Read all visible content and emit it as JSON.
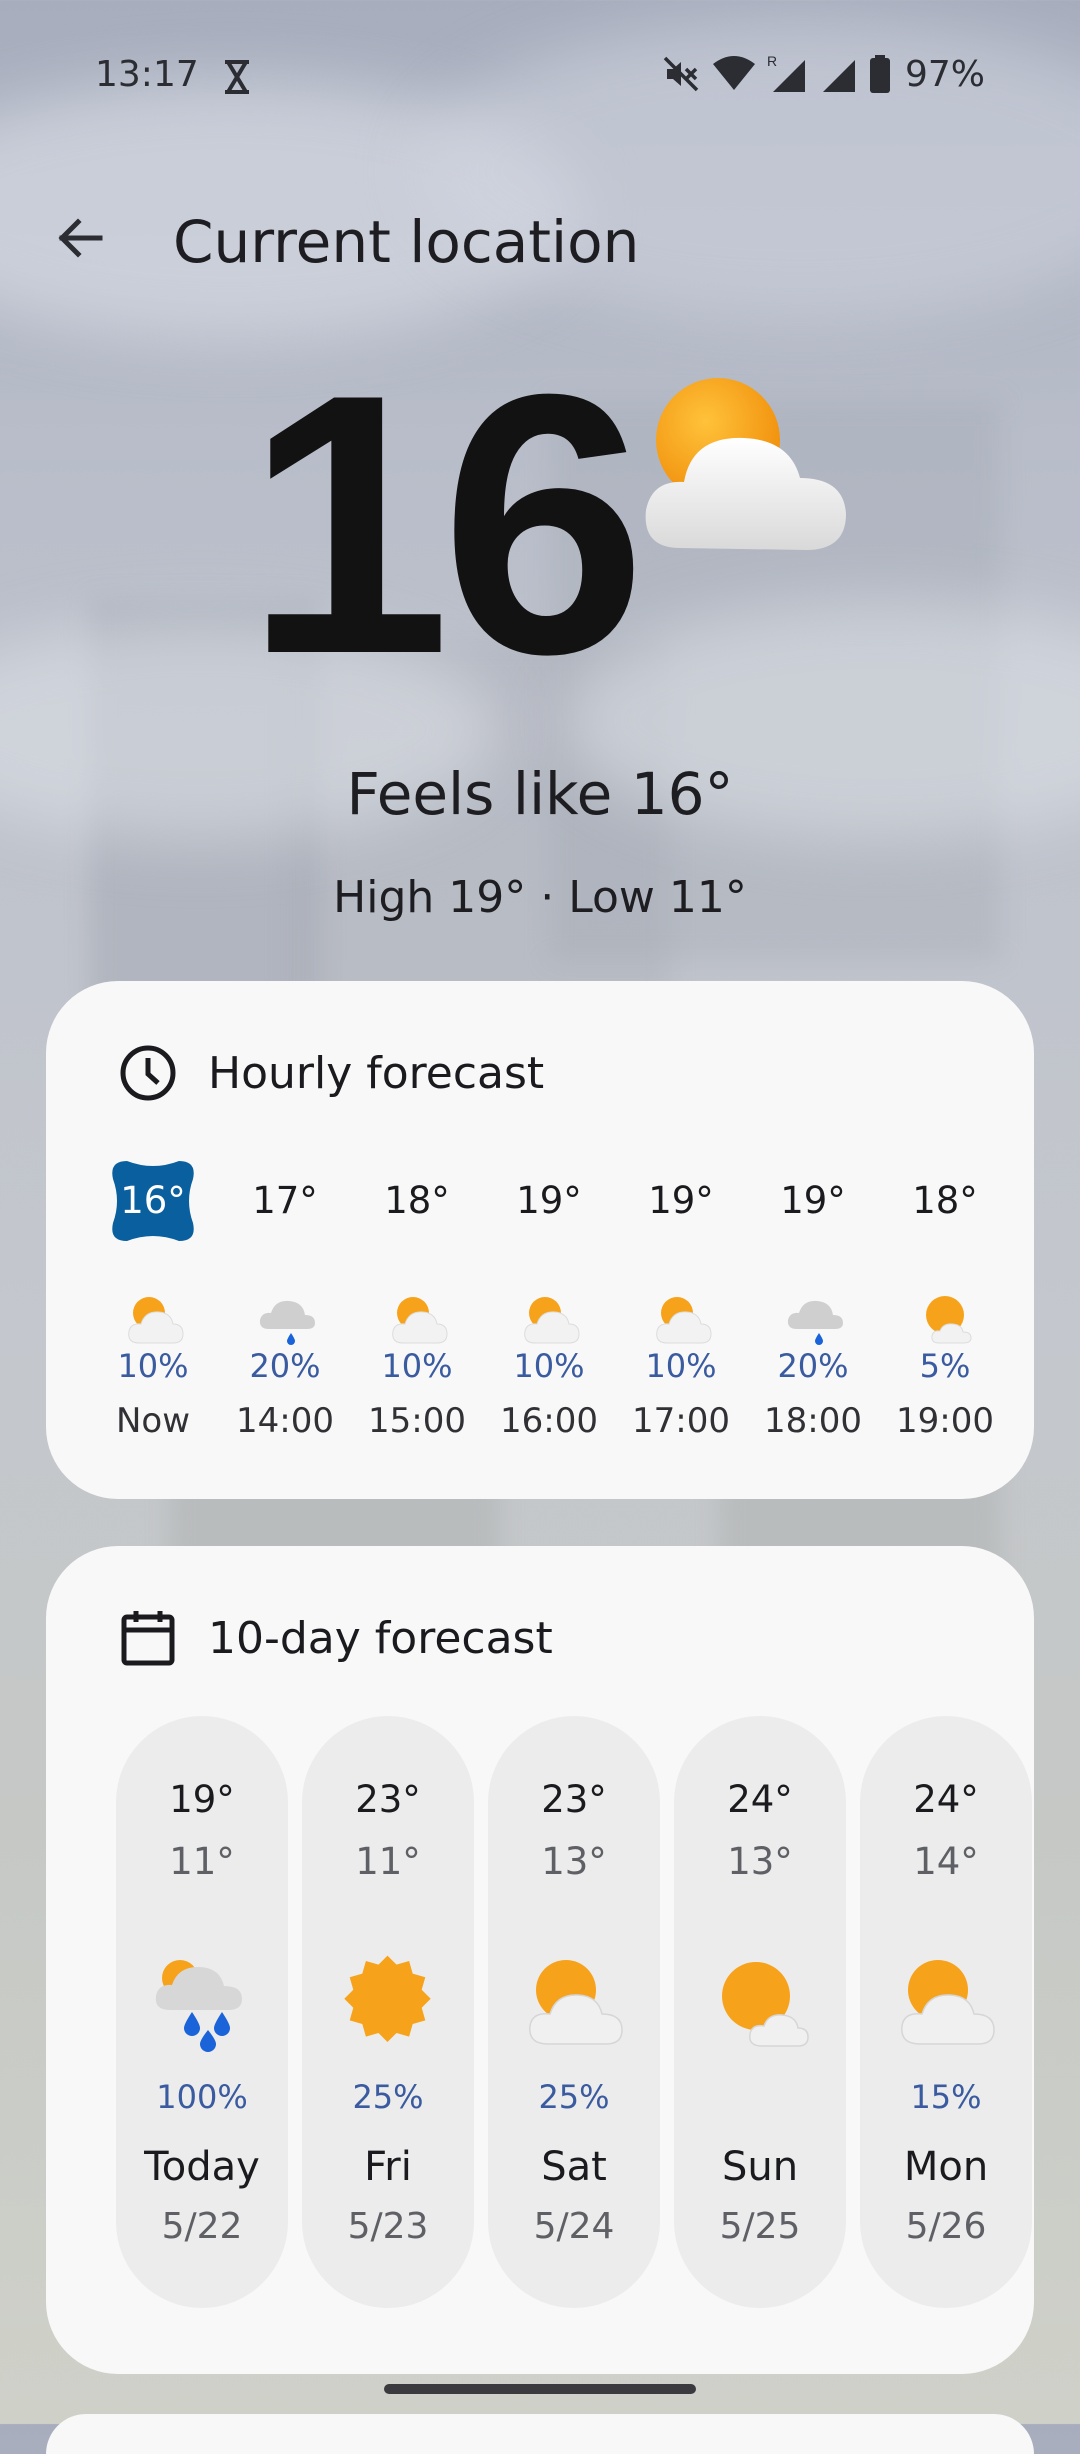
{
  "status_bar": {
    "time": "13:17",
    "battery": "97%",
    "icons": [
      "hourglass-icon",
      "mute-icon",
      "wifi-icon",
      "signal-roaming-icon",
      "signal-icon",
      "battery-icon"
    ]
  },
  "header": {
    "back_icon": "arrow-left-icon",
    "title": "Current location"
  },
  "current": {
    "temperature": "16",
    "condition_icon": "partly-cloudy-icon",
    "feels_like": "Feels like 16°",
    "high_low": "High 19° · Low 11°"
  },
  "hourly": {
    "title": "Hourly forecast",
    "icon": "clock-icon",
    "items": [
      {
        "temp": "16°",
        "icon": "partly-cloudy-icon",
        "pop": "10%",
        "time": "Now",
        "current": true
      },
      {
        "temp": "17°",
        "icon": "cloud-drizzle-icon",
        "pop": "20%",
        "time": "14:00"
      },
      {
        "temp": "18°",
        "icon": "partly-cloudy-icon",
        "pop": "10%",
        "time": "15:00"
      },
      {
        "temp": "19°",
        "icon": "partly-cloudy-icon",
        "pop": "10%",
        "time": "16:00"
      },
      {
        "temp": "19°",
        "icon": "partly-cloudy-icon",
        "pop": "10%",
        "time": "17:00"
      },
      {
        "temp": "19°",
        "icon": "cloud-drizzle-icon",
        "pop": "20%",
        "time": "18:00"
      },
      {
        "temp": "18°",
        "icon": "mostly-sunny-icon",
        "pop": "5%",
        "time": "19:00"
      }
    ]
  },
  "daily": {
    "title": "10-day forecast",
    "icon": "calendar-icon",
    "items": [
      {
        "high": "19°",
        "low": "11°",
        "icon": "rain-showers-icon",
        "pop": "100%",
        "day": "Today",
        "date": "5/22"
      },
      {
        "high": "23°",
        "low": "11°",
        "icon": "sunny-icon",
        "pop": "25%",
        "day": "Fri",
        "date": "5/23"
      },
      {
        "high": "23°",
        "low": "13°",
        "icon": "partly-cloudy-icon",
        "pop": "25%",
        "day": "Sat",
        "date": "5/24"
      },
      {
        "high": "24°",
        "low": "13°",
        "icon": "mostly-sunny-icon",
        "pop": "",
        "day": "Sun",
        "date": "5/25"
      },
      {
        "high": "24°",
        "low": "14°",
        "icon": "partly-cloudy-icon",
        "pop": "15%",
        "day": "Mon",
        "date": "5/26"
      }
    ]
  },
  "colors": {
    "accent_badge": "#0a5f9e",
    "precip_text": "#3a5ba0",
    "card_bg": "#f8f8f8",
    "pill_bg": "#ececec",
    "sun": "#f7a21b",
    "rain": "#1a63d8"
  }
}
